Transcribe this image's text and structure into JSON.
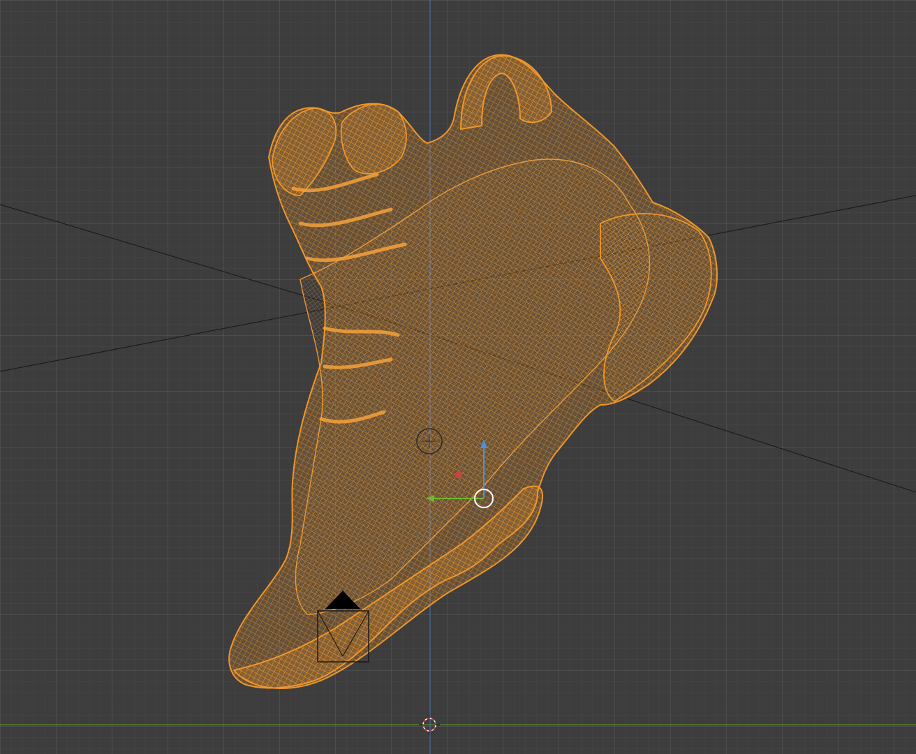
{
  "viewport": {
    "shading_mode": "wireframe",
    "background_color": "#3d3d3d",
    "grid_color": "#4a4a4a"
  },
  "object": {
    "description_icon": "sneaker-wireframe",
    "selected": true,
    "wire_color": "#f0962a"
  },
  "axes": {
    "x_axis_color": "#d04040",
    "y_axis_color": "#6fb830",
    "z_axis_color": "#4f8fe0"
  },
  "gizmos": {
    "origin_icon": "origin-circle-icon",
    "cursor_icon": "3d-cursor-icon",
    "camera_icon": "camera-icon",
    "light_icon": "light-icon"
  }
}
